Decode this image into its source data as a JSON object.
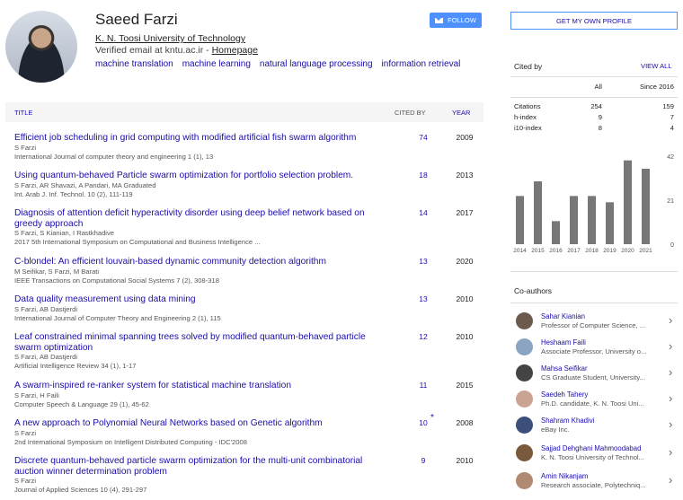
{
  "profile": {
    "name": "Saeed Farzi",
    "affiliation": "K. N. Toosi University of Technology",
    "verified_prefix": "Verified email at kntu.ac.ir - ",
    "homepage": "Homepage",
    "interests": [
      "machine translation",
      "machine learning",
      "natural language processing",
      "information retrieval"
    ],
    "follow_label": "FOLLOW"
  },
  "table": {
    "col_title": "TITLE",
    "col_cited": "CITED BY",
    "col_year": "YEAR",
    "rows": [
      {
        "title": "Efficient job scheduling in grid computing with modified artificial fish swarm algorithm",
        "authors": "S Farzi",
        "venue": "International Journal of computer theory and engineering 1 (1), 13",
        "cites": "74",
        "year": "2009",
        "star": ""
      },
      {
        "title": "Using quantum-behaved Particle swarm optimization for portfolio selection problem.",
        "authors": "S Farzi, AR Shavazi, A Pandari, MA Graduated",
        "venue": "Int. Arab J. Inf. Technol. 10 (2), 111-119",
        "cites": "18",
        "year": "2013",
        "star": ""
      },
      {
        "title": "Diagnosis of attention deficit hyperactivity disorder using deep belief network based on greedy approach",
        "authors": "S Farzi, S Kianian, I Rastkhadive",
        "venue": "2017 5th International Symposium on Computational and Business Intelligence ...",
        "cites": "14",
        "year": "2017",
        "star": ""
      },
      {
        "title": "C-blondel: An efficient louvain-based dynamic community detection algorithm",
        "authors": "M Seifikar, S Farzi, M Barati",
        "venue": "IEEE Transactions on Computational Social Systems 7 (2), 308-318",
        "cites": "13",
        "year": "2020",
        "star": ""
      },
      {
        "title": "Data quality measurement using data mining",
        "authors": "S Farzi, AB Dastjerdi",
        "venue": "International Journal of Computer Theory and Engineering 2 (1), 115",
        "cites": "13",
        "year": "2010",
        "star": ""
      },
      {
        "title": "Leaf constrained minimal spanning trees solved by modified quantum-behaved particle swarm optimization",
        "authors": "S Farzi, AB Dastjerdi",
        "venue": "Artificial Intelligence Review 34 (1), 1-17",
        "cites": "12",
        "year": "2010",
        "star": ""
      },
      {
        "title": "A swarm-inspired re-ranker system for statistical machine translation",
        "authors": "S Farzi, H Faili",
        "venue": "Computer Speech & Language 29 (1), 45-62",
        "cites": "11",
        "year": "2015",
        "star": ""
      },
      {
        "title": "A new approach to Polynomial Neural Networks based on Genetic algorithm",
        "authors": "S Farzi",
        "venue": "2nd International Symposium on Intelligent Distributed Computing - IDC'2008",
        "cites": "10",
        "year": "2008",
        "star": "*"
      },
      {
        "title": "Discrete quantum-behaved particle swarm optimization for the multi-unit combinatorial auction winner determination problem",
        "authors": "S Farzi",
        "venue": "Journal of Applied Sciences 10 (4), 291-297",
        "cites": "9",
        "year": "2010",
        "star": ""
      }
    ]
  },
  "sidebar": {
    "my_profile": "GET MY OWN PROFILE",
    "cited_by": "Cited by",
    "view_all": "VIEW ALL",
    "col_all": "All",
    "col_since": "Since 2016",
    "stats": [
      {
        "label": "Citations",
        "all": "254",
        "since": "159"
      },
      {
        "label": "h-index",
        "all": "9",
        "since": "7"
      },
      {
        "label": "i10-index",
        "all": "8",
        "since": "4"
      }
    ],
    "coauthors_title": "Co-authors",
    "coauthors": [
      {
        "name": "Sahar Kianian",
        "desc": "Professor of Computer Science, ..."
      },
      {
        "name": "Heshaam Faili",
        "desc": "Associate Professor, University o..."
      },
      {
        "name": "Mahsa Seifikar",
        "desc": "CS Graduate Student, University..."
      },
      {
        "name": "Saedeh Tahery",
        "desc": "Ph.D. candidate, K. N. Toosi Uni..."
      },
      {
        "name": "Shahram Khadivi",
        "desc": "eBay Inc."
      },
      {
        "name": "Sajjad Dehghani Mahmoodabad",
        "desc": "K. N. Toosi University of Technol..."
      },
      {
        "name": "Amin Nikanjam",
        "desc": "Research associate, Polytechniq..."
      }
    ]
  },
  "chart_data": {
    "type": "bar",
    "categories": [
      "2014",
      "2015",
      "2016",
      "2017",
      "2018",
      "2019",
      "2020",
      "2021"
    ],
    "values": [
      23,
      30,
      11,
      23,
      23,
      20,
      40,
      36
    ],
    "y_ticks": [
      "42",
      "21",
      "0"
    ],
    "ylim": [
      0,
      42
    ],
    "bar_color": "#777777"
  }
}
